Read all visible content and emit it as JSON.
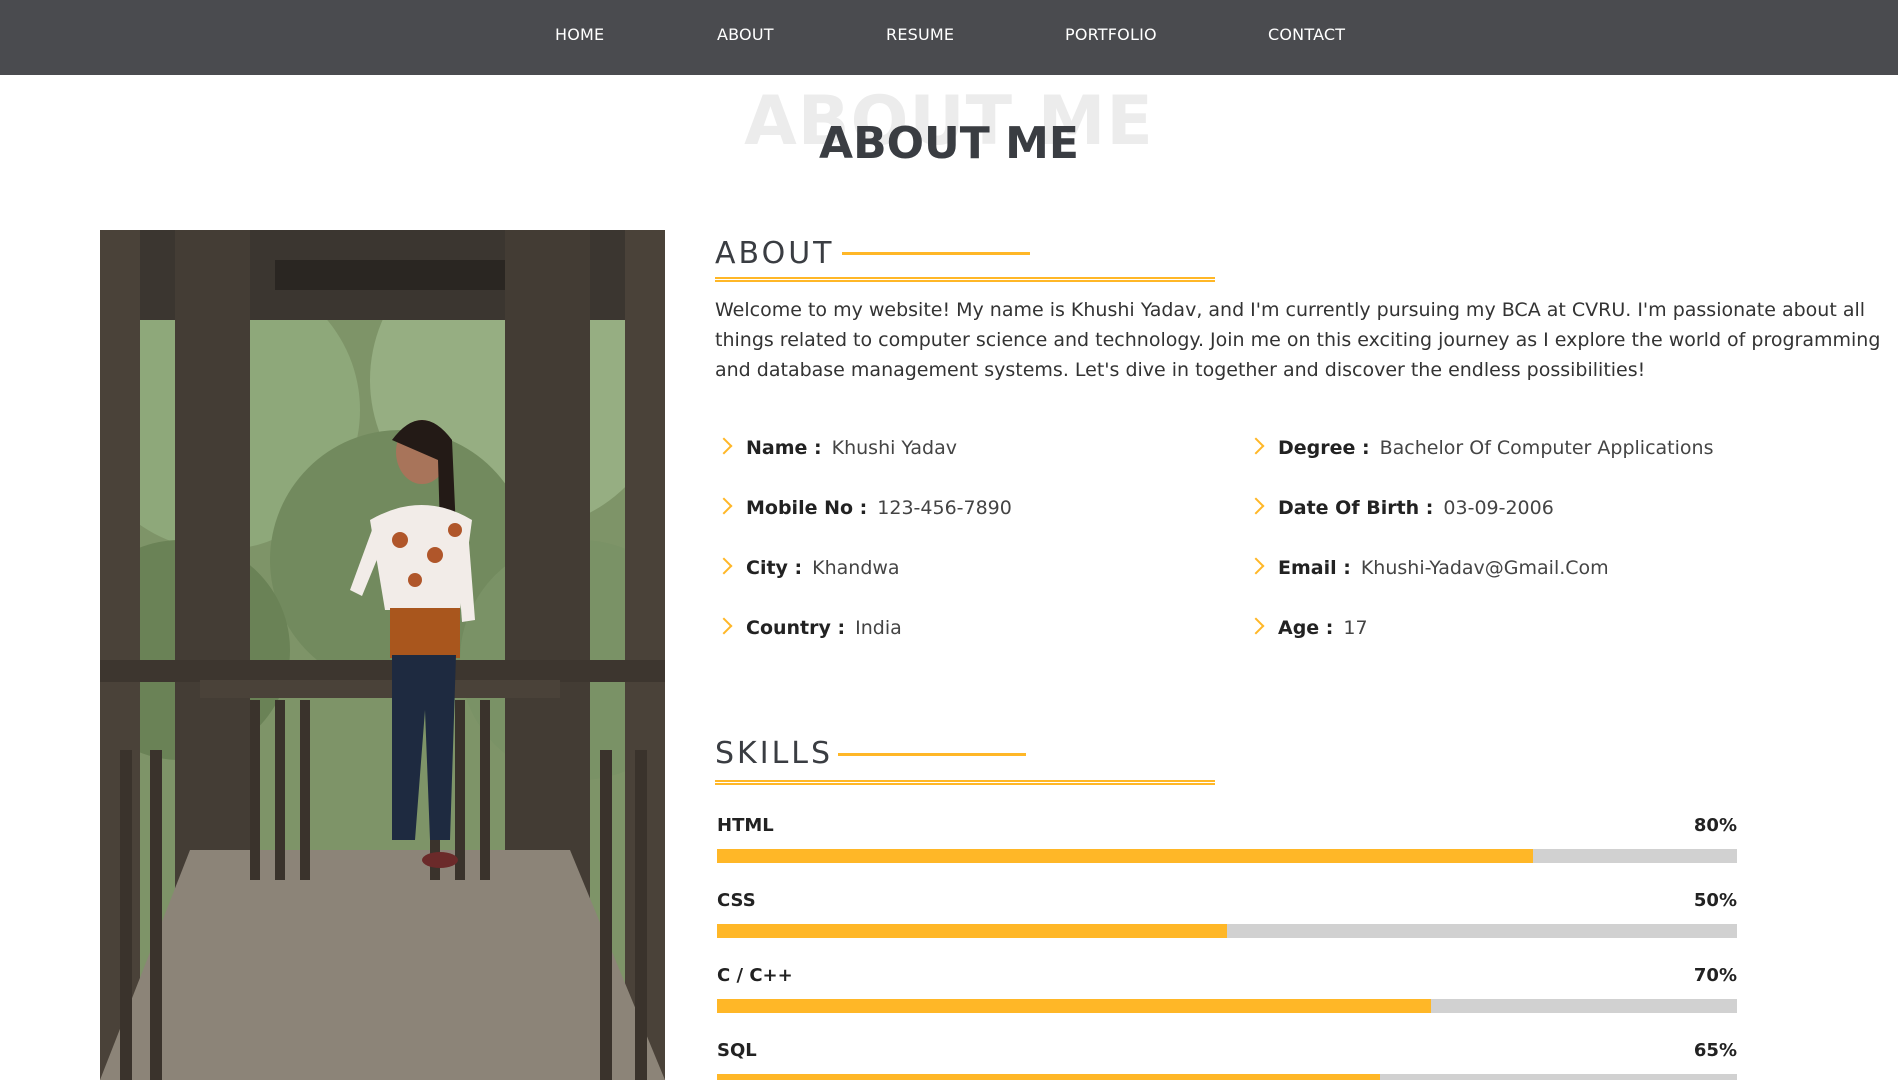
{
  "nav": {
    "items": [
      {
        "label": "HOME"
      },
      {
        "label": "ABOUT"
      },
      {
        "label": "RESUME"
      },
      {
        "label": "PORTFOLIO"
      },
      {
        "label": "CONTACT"
      }
    ]
  },
  "section": {
    "bg_title": "ABOUT ME",
    "title": "ABOUT ME"
  },
  "about": {
    "heading": "ABOUT",
    "text": "Welcome to my website! My name is Khushi Yadav, and I'm currently pursuing my BCA at CVRU. I'm passionate about all things related to computer science and technology. Join me on this exciting journey as I explore the world of programming and database management systems. Let's dive in together and discover the endless possibilities!"
  },
  "info": {
    "left": [
      {
        "label": "Name :",
        "value": "Khushi Yadav"
      },
      {
        "label": "Mobile No :",
        "value": "123-456-7890"
      },
      {
        "label": "City :",
        "value": "Khandwa"
      },
      {
        "label": "Country :",
        "value": "India"
      }
    ],
    "right": [
      {
        "label": "Degree :",
        "value": "Bachelor Of Computer Applications"
      },
      {
        "label": "Date Of Birth :",
        "value": "03-09-2006"
      },
      {
        "label": "Email :",
        "value": "Khushi-Yadav@Gmail.Com"
      },
      {
        "label": "Age :",
        "value": "17"
      }
    ]
  },
  "skills": {
    "heading": "SKILLS",
    "items": [
      {
        "name": "HTML",
        "percent_label": "80%",
        "percent": 80
      },
      {
        "name": "CSS",
        "percent_label": "50%",
        "percent": 50
      },
      {
        "name": "C / C++",
        "percent_label": "70%",
        "percent": 70
      },
      {
        "name": "SQL",
        "percent_label": "65%",
        "percent": 65
      }
    ]
  },
  "colors": {
    "accent": "#ffb727",
    "nav_bg": "#4a4b4f",
    "bar_track": "#d1d1d1"
  }
}
